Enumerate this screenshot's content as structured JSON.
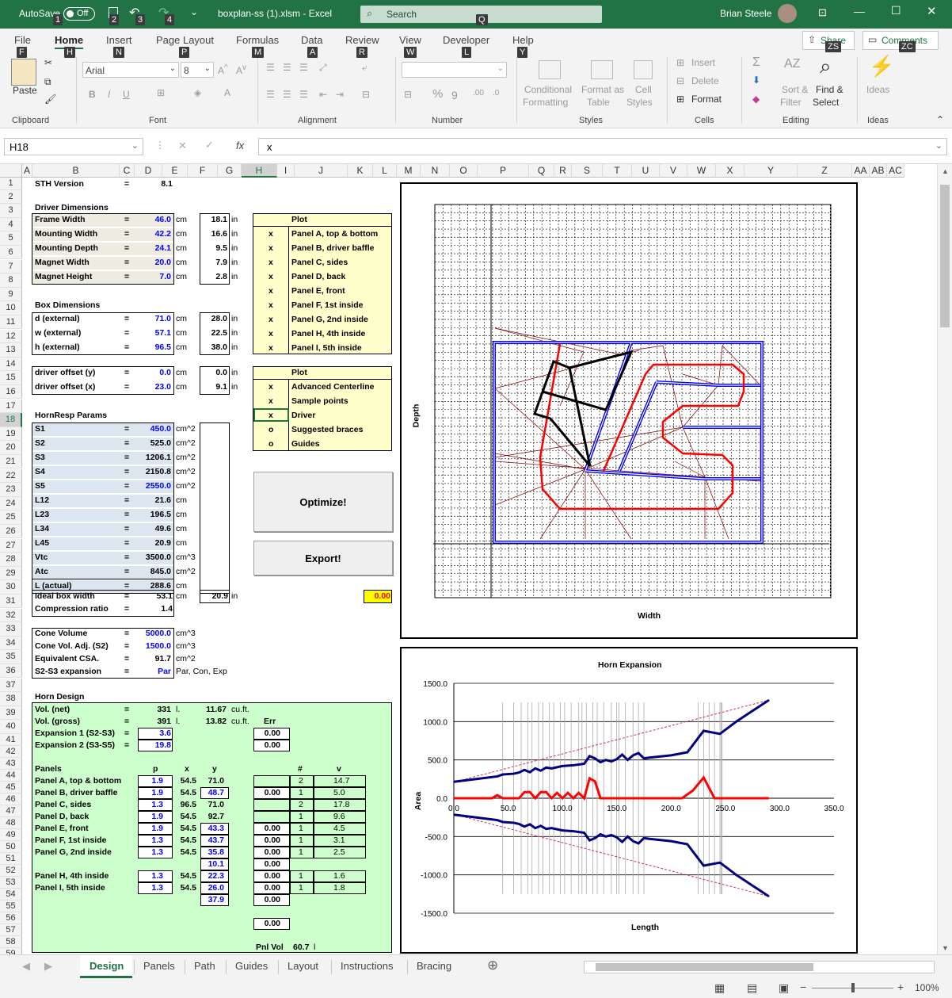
{
  "titlebar": {
    "autosave": "AutoSave",
    "autosave_state": "Off",
    "filename": "boxplan-ss (1).xlsm - Excel",
    "search": "Search",
    "user": "Brian Steele"
  },
  "keytips": {
    "k1": "1",
    "k2": "2",
    "k3": "3",
    "k4": "4",
    "kq": "Q",
    "kf": "F",
    "kh": "H",
    "kn": "N",
    "kp": "P",
    "km": "M",
    "ka": "A",
    "kr": "R",
    "kw": "W",
    "kl": "L",
    "ky": "Y",
    "kzs": "ZS",
    "kzc": "ZC"
  },
  "menu": {
    "file": "File",
    "home": "Home",
    "insert": "Insert",
    "page_layout": "Page Layout",
    "formulas": "Formulas",
    "data": "Data",
    "review": "Review",
    "view": "View",
    "developer": "Developer",
    "help": "Help",
    "share": "Share",
    "comments": "Comments"
  },
  "ribbon": {
    "paste": "Paste",
    "clipboard": "Clipboard",
    "font_name": "Arial",
    "font_size": "8",
    "font": "Font",
    "alignment": "Alignment",
    "number": "Number",
    "conditional": "Conditional",
    "formatting": "Formatting",
    "format_as": "Format as",
    "table": "Table",
    "cell": "Cell",
    "styles_btn": "Styles",
    "styles": "Styles",
    "insert": "Insert",
    "delete": "Delete",
    "format": "Format",
    "cells": "Cells",
    "sort": "Sort &",
    "filter": "Filter",
    "find": "Find &",
    "select": "Select",
    "editing": "Editing",
    "ideas_btn": "Ideas",
    "ideas": "Ideas"
  },
  "formula": {
    "namebox": "H18",
    "fx": "fx",
    "value": "x"
  },
  "cols": [
    "A",
    "B",
    "C",
    "D",
    "E",
    "F",
    "G",
    "H",
    "I",
    "J",
    "K",
    "L",
    "M",
    "N",
    "O",
    "P",
    "Q",
    "R",
    "S",
    "T",
    "U",
    "V",
    "W",
    "X",
    "Y",
    "Z",
    "AA",
    "AB",
    "AC"
  ],
  "sheet": {
    "r1": {
      "b": "STH Version",
      "c": "=",
      "d": "8.1"
    },
    "r3": "Driver Dimensions",
    "driver": [
      {
        "label": "Frame Width",
        "eq": "=",
        "cm": "46.0",
        "unit": "cm",
        "inch": "18.1",
        "iu": "in"
      },
      {
        "label": "Mounting Width",
        "eq": "=",
        "cm": "42.2",
        "unit": "cm",
        "inch": "16.6",
        "iu": "in"
      },
      {
        "label": "Mounting Depth",
        "eq": "=",
        "cm": "24.1",
        "unit": "cm",
        "inch": "9.5",
        "iu": "in"
      },
      {
        "label": "Magnet Width",
        "eq": "=",
        "cm": "20.0",
        "unit": "cm",
        "inch": "7.9",
        "iu": "in"
      },
      {
        "label": "Magnet Height",
        "eq": "=",
        "cm": "7.0",
        "unit": "cm",
        "inch": "2.8",
        "iu": "in"
      }
    ],
    "r10": "Box Dimensions",
    "box": [
      {
        "label": "d (external)",
        "eq": "=",
        "cm": "71.0",
        "unit": "cm",
        "inch": "28.0",
        "iu": "in"
      },
      {
        "label": "w (external)",
        "eq": "=",
        "cm": "57.1",
        "unit": "cm",
        "inch": "22.5",
        "iu": "in"
      },
      {
        "label": "h (external)",
        "eq": "=",
        "cm": "96.5",
        "unit": "cm",
        "inch": "38.0",
        "iu": "in"
      }
    ],
    "offset": [
      {
        "label": "driver offset (y)",
        "eq": "=",
        "cm": "0.0",
        "unit": "cm",
        "inch": "0.0",
        "iu": "in"
      },
      {
        "label": "driver offset (x)",
        "eq": "=",
        "cm": "23.0",
        "unit": "cm",
        "inch": "9.1",
        "iu": "in"
      }
    ],
    "r18": "HornResp Params",
    "horn": [
      {
        "label": "S1",
        "eq": "=",
        "v": "450.0",
        "u": "cm^2"
      },
      {
        "label": "S2",
        "eq": "=",
        "v": "525.0",
        "u": "cm^2"
      },
      {
        "label": "S3",
        "eq": "=",
        "v": "1206.1",
        "u": "cm^2"
      },
      {
        "label": "S4",
        "eq": "=",
        "v": "2150.8",
        "u": "cm^2"
      },
      {
        "label": "S5",
        "eq": "=",
        "v": "2550.0",
        "u": "cm^2"
      },
      {
        "label": "L12",
        "eq": "=",
        "v": "21.6",
        "u": "cm"
      },
      {
        "label": "L23",
        "eq": "=",
        "v": "196.5",
        "u": "cm"
      },
      {
        "label": "L34",
        "eq": "=",
        "v": "49.6",
        "u": "cm"
      },
      {
        "label": "L45",
        "eq": "=",
        "v": "20.9",
        "u": "cm"
      },
      {
        "label": "Vtc",
        "eq": "=",
        "v": "3500.0",
        "u": "cm^3"
      },
      {
        "label": "Atc",
        "eq": "=",
        "v": "845.0",
        "u": "cm^2"
      },
      {
        "label": "L (actual)",
        "eq": "=",
        "v": "288.6",
        "u": "cm"
      }
    ],
    "r32": {
      "label": "Ideal box width",
      "eq": "=",
      "v": "53.1",
      "u": "cm",
      "inch": "20.9",
      "iu": "in",
      "k": "0.00"
    },
    "r33": {
      "label": "Compression ratio",
      "eq": "=",
      "v": "1.4"
    },
    "cone": [
      {
        "label": "Cone Volume",
        "eq": "=",
        "v": "5000.0",
        "u": "cm^3"
      },
      {
        "label": "Cone Vol. Adj. (S2)",
        "eq": "=",
        "v": "1500.0",
        "u": "cm^3"
      },
      {
        "label": "Equivalent CSA.",
        "eq": "=",
        "v": "91.7",
        "u": "cm^2"
      },
      {
        "label": "S2-S3 expansion",
        "eq": "=",
        "v": "Par",
        "u": "Par, Con, Exp"
      }
    ],
    "r40": "Horn Design",
    "r41": {
      "label": "Vol. (net)",
      "eq": "=",
      "v": "331",
      "u": "l.",
      "ft": "11.67",
      "fu": "cu.ft."
    },
    "r42": {
      "label": "Vol. (gross)",
      "eq": "=",
      "v": "391",
      "u": "l.",
      "ft": "13.82",
      "fu": "cu.ft.",
      "err": "Err"
    },
    "r43": {
      "label": "Expansion 1 (S2-S3)",
      "eq": "=",
      "v": "3.6",
      "h": "0.00"
    },
    "r44": {
      "label": "Expansion 2 (S3-S5)",
      "eq": "=",
      "v": "19.8",
      "h": "0.00"
    },
    "r46": {
      "label": "Panels",
      "p": "p",
      "x": "x",
      "y": "y",
      "n": "#",
      "v": "v"
    },
    "panels": [
      {
        "label": "Panel A, top & bottom",
        "p": "1.9",
        "x": "54.5",
        "y": "71.0",
        "h": "",
        "n": "2",
        "v": "14.7"
      },
      {
        "label": "Panel B, driver baffle",
        "p": "1.9",
        "x": "54.5",
        "y": "48.7",
        "h": "0.00",
        "n": "1",
        "v": "5.0"
      },
      {
        "label": "Panel C, sides",
        "p": "1.3",
        "x": "96.5",
        "y": "71.0",
        "h": "",
        "n": "2",
        "v": "17.8"
      },
      {
        "label": "Panel D, back",
        "p": "1.9",
        "x": "54.5",
        "y": "92.7",
        "h": "",
        "n": "1",
        "v": "9.6"
      },
      {
        "label": "Panel E, front",
        "p": "1.9",
        "x": "54.5",
        "y": "43.3",
        "h": "0.00",
        "n": "1",
        "v": "4.5"
      },
      {
        "label": "Panel F, 1st inside",
        "p": "1.3",
        "x": "54.5",
        "y": "43.7",
        "h": "0.00",
        "n": "1",
        "v": "3.1"
      },
      {
        "label": "Panel G, 2nd inside",
        "p": "1.3",
        "x": "54.5",
        "y": "35.8",
        "h": "0.00",
        "n": "1",
        "v": "2.5"
      },
      {
        "label": "",
        "p": "",
        "x": "",
        "y": "10.1",
        "h": "0.00",
        "n": "",
        "v": ""
      },
      {
        "label": "Panel H, 4th inside",
        "p": "1.3",
        "x": "54.5",
        "y": "22.3",
        "h": "0.00",
        "n": "1",
        "v": "1.6"
      },
      {
        "label": "Panel I, 5th inside",
        "p": "1.3",
        "x": "54.5",
        "y": "26.0",
        "h": "0.00",
        "n": "1",
        "v": "1.8"
      },
      {
        "label": "",
        "p": "",
        "x": "",
        "y": "37.9",
        "h": "0.00",
        "n": "",
        "v": ""
      }
    ],
    "r59": "0.00",
    "r61": {
      "label": "Pnl Vol",
      "v": "60.7",
      "u": "l"
    },
    "plot1": {
      "title": "Plot",
      "rows": [
        [
          "x",
          "Panel A, top & bottom"
        ],
        [
          "x",
          "Panel B, driver baffle"
        ],
        [
          "x",
          "Panel C, sides"
        ],
        [
          "x",
          "Panel D, back"
        ],
        [
          "x",
          "Panel E, front"
        ],
        [
          "x",
          "Panel F, 1st inside"
        ],
        [
          "x",
          "Panel G, 2nd inside"
        ],
        [
          "x",
          "Panel H, 4th inside"
        ],
        [
          "x",
          "Panel I, 5th inside"
        ]
      ]
    },
    "plot2": {
      "title": "Plot",
      "rows": [
        [
          "x",
          "Advanced Centerline"
        ],
        [
          "x",
          "Sample points"
        ],
        [
          "x",
          "Driver"
        ],
        [
          "o",
          "Suggested braces"
        ],
        [
          "o",
          "Guides"
        ]
      ]
    },
    "optimize": "Optimize!",
    "export": "Export!"
  },
  "layout_chart": {
    "xlabel": "Width",
    "ylabel": "Depth"
  },
  "chart_data": {
    "type": "line",
    "title": "Horn Expansion",
    "xlabel": "Length",
    "ylabel": "Area",
    "xlim": [
      0,
      350
    ],
    "ylim": [
      -1500,
      1500
    ],
    "xticks": [
      "0.0",
      "50.0",
      "100.0",
      "150.0",
      "200.0",
      "250.0",
      "300.0",
      "350.0"
    ],
    "yticks": [
      "1500.0",
      "1000.0",
      "500.0",
      "0.0",
      "-500.0",
      "-1000.0",
      "-1500.0"
    ],
    "series": [
      {
        "color": "#000080",
        "x": [
          0,
          20,
          40,
          45,
          55,
          60,
          65,
          70,
          75,
          80,
          85,
          90,
          100,
          110,
          120,
          125,
          130,
          135,
          140,
          145,
          150,
          155,
          160,
          165,
          170,
          175,
          180,
          200,
          215,
          230,
          245,
          260,
          275,
          290
        ],
        "y": [
          215,
          250,
          285,
          310,
          320,
          335,
          370,
          340,
          390,
          360,
          400,
          390,
          420,
          430,
          450,
          550,
          520,
          470,
          500,
          480,
          510,
          570,
          500,
          560,
          590,
          520,
          530,
          560,
          600,
          880,
          840,
          1000,
          1140,
          1280
        ]
      },
      {
        "color": "#ff0000",
        "x": [
          0,
          35,
          40,
          45,
          50,
          60,
          65,
          70,
          75,
          80,
          85,
          90,
          95,
          100,
          105,
          110,
          115,
          120,
          125,
          130,
          135,
          140,
          210,
          220,
          230,
          240,
          250,
          290
        ],
        "y": [
          0,
          0,
          40,
          0,
          0,
          0,
          80,
          80,
          0,
          80,
          80,
          0,
          70,
          0,
          70,
          0,
          70,
          0,
          260,
          220,
          0,
          0,
          0,
          100,
          270,
          0,
          0,
          0
        ]
      },
      {
        "color": "#000080",
        "x": [
          0,
          20,
          40,
          45,
          55,
          60,
          65,
          70,
          75,
          80,
          85,
          90,
          100,
          110,
          120,
          125,
          130,
          135,
          140,
          145,
          150,
          155,
          160,
          165,
          170,
          175,
          180,
          200,
          215,
          230,
          245,
          260,
          275,
          290
        ],
        "y": [
          -215,
          -250,
          -285,
          -310,
          -320,
          -335,
          -370,
          -340,
          -390,
          -360,
          -400,
          -390,
          -420,
          -430,
          -450,
          -550,
          -520,
          -470,
          -500,
          -480,
          -510,
          -570,
          -500,
          -560,
          -590,
          -520,
          -530,
          -560,
          -600,
          -880,
          -840,
          -1000,
          -1140,
          -1280
        ]
      }
    ]
  },
  "tabs": [
    "Design",
    "Panels",
    "Path",
    "Guides",
    "Layout",
    "Instructions",
    "Bracing"
  ],
  "status": {
    "zoom": "100%"
  }
}
